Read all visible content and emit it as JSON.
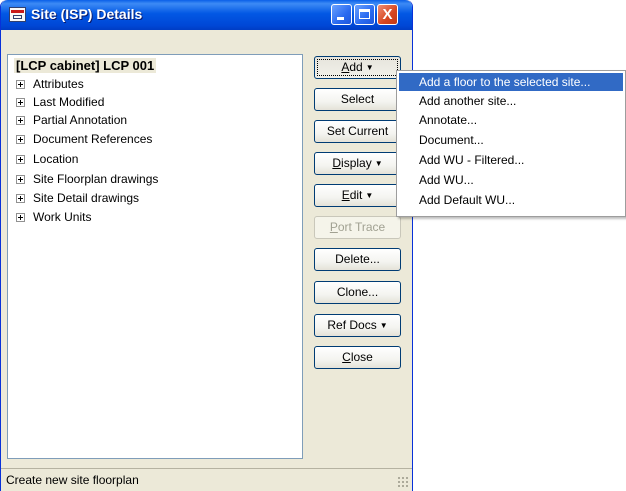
{
  "window": {
    "title": "Site (ISP) Details",
    "icon": "network-app-icon",
    "controls": {
      "minimize": "minimize-icon",
      "maximize": "maximize-icon",
      "close": "close-icon",
      "close_glyph": "X"
    }
  },
  "tree": {
    "root_label": "[LCP cabinet] LCP 001",
    "expander_icon": "plus-expander-icon",
    "items": [
      {
        "label": "Attributes"
      },
      {
        "label": "Last Modified"
      },
      {
        "label": "Partial Annotation"
      },
      {
        "label": "Document References"
      },
      {
        "label": "Location"
      },
      {
        "label": "Site Floorplan drawings"
      },
      {
        "label": "Site Detail drawings"
      },
      {
        "label": "Work Units"
      }
    ]
  },
  "buttons": {
    "add": {
      "pre": "",
      "mn": "A",
      "post": "dd"
    },
    "select": "Select",
    "set_current": "Set Current",
    "display": {
      "pre": "",
      "mn": "D",
      "post": "isplay"
    },
    "edit": {
      "pre": "",
      "mn": "E",
      "post": "dit"
    },
    "port_trace": {
      "pre": "",
      "mn": "P",
      "post": "ort Trace"
    },
    "delete": "Delete...",
    "clone": "Clone...",
    "ref_docs": "Ref Docs",
    "close": {
      "pre": "",
      "mn": "C",
      "post": "lose"
    },
    "dropdown_arrow": "▼"
  },
  "add_menu": {
    "items": [
      "Add a floor to the selected site...",
      "Add another site...",
      "Annotate...",
      "Document...",
      "Add WU - Filtered...",
      "Add WU...",
      "Add Default WU..."
    ],
    "highlighted_index": 0
  },
  "status": {
    "text": "Create new site floorplan"
  },
  "colors": {
    "titlebar": "#0258e4",
    "menu_highlight": "#316ac5",
    "window_bg": "#ece9d8"
  }
}
